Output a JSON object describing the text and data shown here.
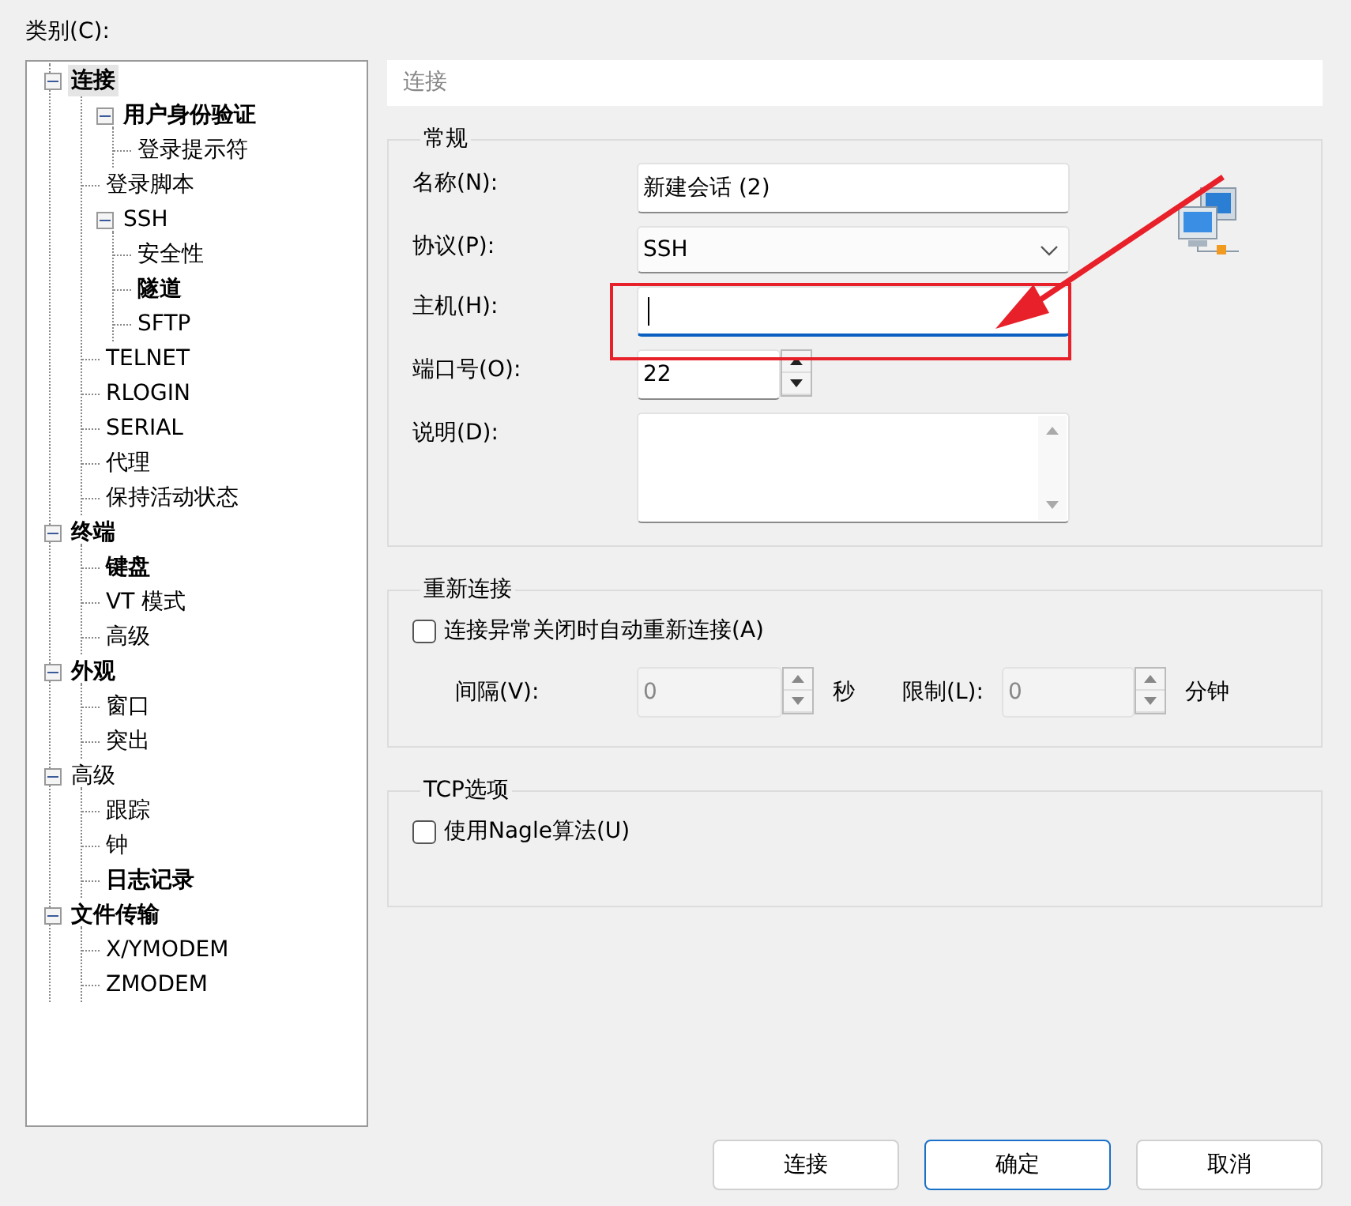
{
  "category_label": "类别(C):",
  "tree": [
    {
      "label": "连接",
      "bold": true,
      "selected": true,
      "expanded": true,
      "children": [
        {
          "label": "用户身份验证",
          "bold": true,
          "selected": false,
          "expanded": true,
          "children": [
            {
              "label": "登录提示符",
              "bold": false,
              "selected": false
            }
          ]
        },
        {
          "label": "登录脚本",
          "bold": false,
          "selected": false
        },
        {
          "label": "SSH",
          "bold": false,
          "selected": false,
          "expanded": true,
          "children": [
            {
              "label": "安全性",
              "bold": false,
              "selected": false
            },
            {
              "label": "隧道",
              "bold": true,
              "selected": false
            },
            {
              "label": "SFTP",
              "bold": false,
              "selected": false
            }
          ]
        },
        {
          "label": "TELNET",
          "bold": false,
          "selected": false
        },
        {
          "label": "RLOGIN",
          "bold": false,
          "selected": false
        },
        {
          "label": "SERIAL",
          "bold": false,
          "selected": false
        },
        {
          "label": "代理",
          "bold": false,
          "selected": false
        },
        {
          "label": "保持活动状态",
          "bold": false,
          "selected": false
        }
      ]
    },
    {
      "label": "终端",
      "bold": true,
      "selected": false,
      "expanded": true,
      "children": [
        {
          "label": "键盘",
          "bold": true,
          "selected": false
        },
        {
          "label": "VT 模式",
          "bold": false,
          "selected": false
        },
        {
          "label": "高级",
          "bold": false,
          "selected": false
        }
      ]
    },
    {
      "label": "外观",
      "bold": true,
      "selected": false,
      "expanded": true,
      "children": [
        {
          "label": "窗口",
          "bold": false,
          "selected": false
        },
        {
          "label": "突出",
          "bold": false,
          "selected": false
        }
      ]
    },
    {
      "label": "高级",
      "bold": false,
      "selected": false,
      "expanded": true,
      "children": [
        {
          "label": "跟踪",
          "bold": false,
          "selected": false
        },
        {
          "label": "钟",
          "bold": false,
          "selected": false
        },
        {
          "label": "日志记录",
          "bold": true,
          "selected": false
        }
      ]
    },
    {
      "label": "文件传输",
      "bold": true,
      "selected": false,
      "expanded": true,
      "children": [
        {
          "label": "X/YMODEM",
          "bold": false,
          "selected": false
        },
        {
          "label": "ZMODEM",
          "bold": false,
          "selected": false
        }
      ]
    }
  ],
  "page_title": "连接",
  "general": {
    "title": "常规",
    "fields": [
      {
        "kind": "text",
        "label": "名称(N):",
        "value": "新建会话 (2)",
        "focused": false
      },
      {
        "kind": "select",
        "label": "协议(P):",
        "value": "SSH"
      },
      {
        "kind": "text",
        "label": "主机(H):",
        "focused": true
      },
      {
        "kind": "spin",
        "label": "端口号(O):",
        "value": "22",
        "disabled": false
      },
      {
        "kind": "memo",
        "label": "说明(D):"
      }
    ]
  },
  "reconnect": {
    "title": "重新连接",
    "checkbox": {
      "label": "连接异常关闭时自动重新连接(A)",
      "checked": false
    },
    "interval": {
      "label": "间隔(V):",
      "value": "0",
      "disabled": true,
      "unit": "秒"
    },
    "limit": {
      "label": "限制(L):",
      "value": "0",
      "disabled": true,
      "unit": "分钟"
    }
  },
  "tcp": {
    "title": "TCP选项",
    "checkbox": {
      "label": "使用Nagle算法(U)",
      "checked": false
    }
  },
  "buttons": [
    {
      "label": "连接",
      "default": false
    },
    {
      "label": "确定",
      "default": true
    },
    {
      "label": "取消",
      "default": false
    }
  ]
}
